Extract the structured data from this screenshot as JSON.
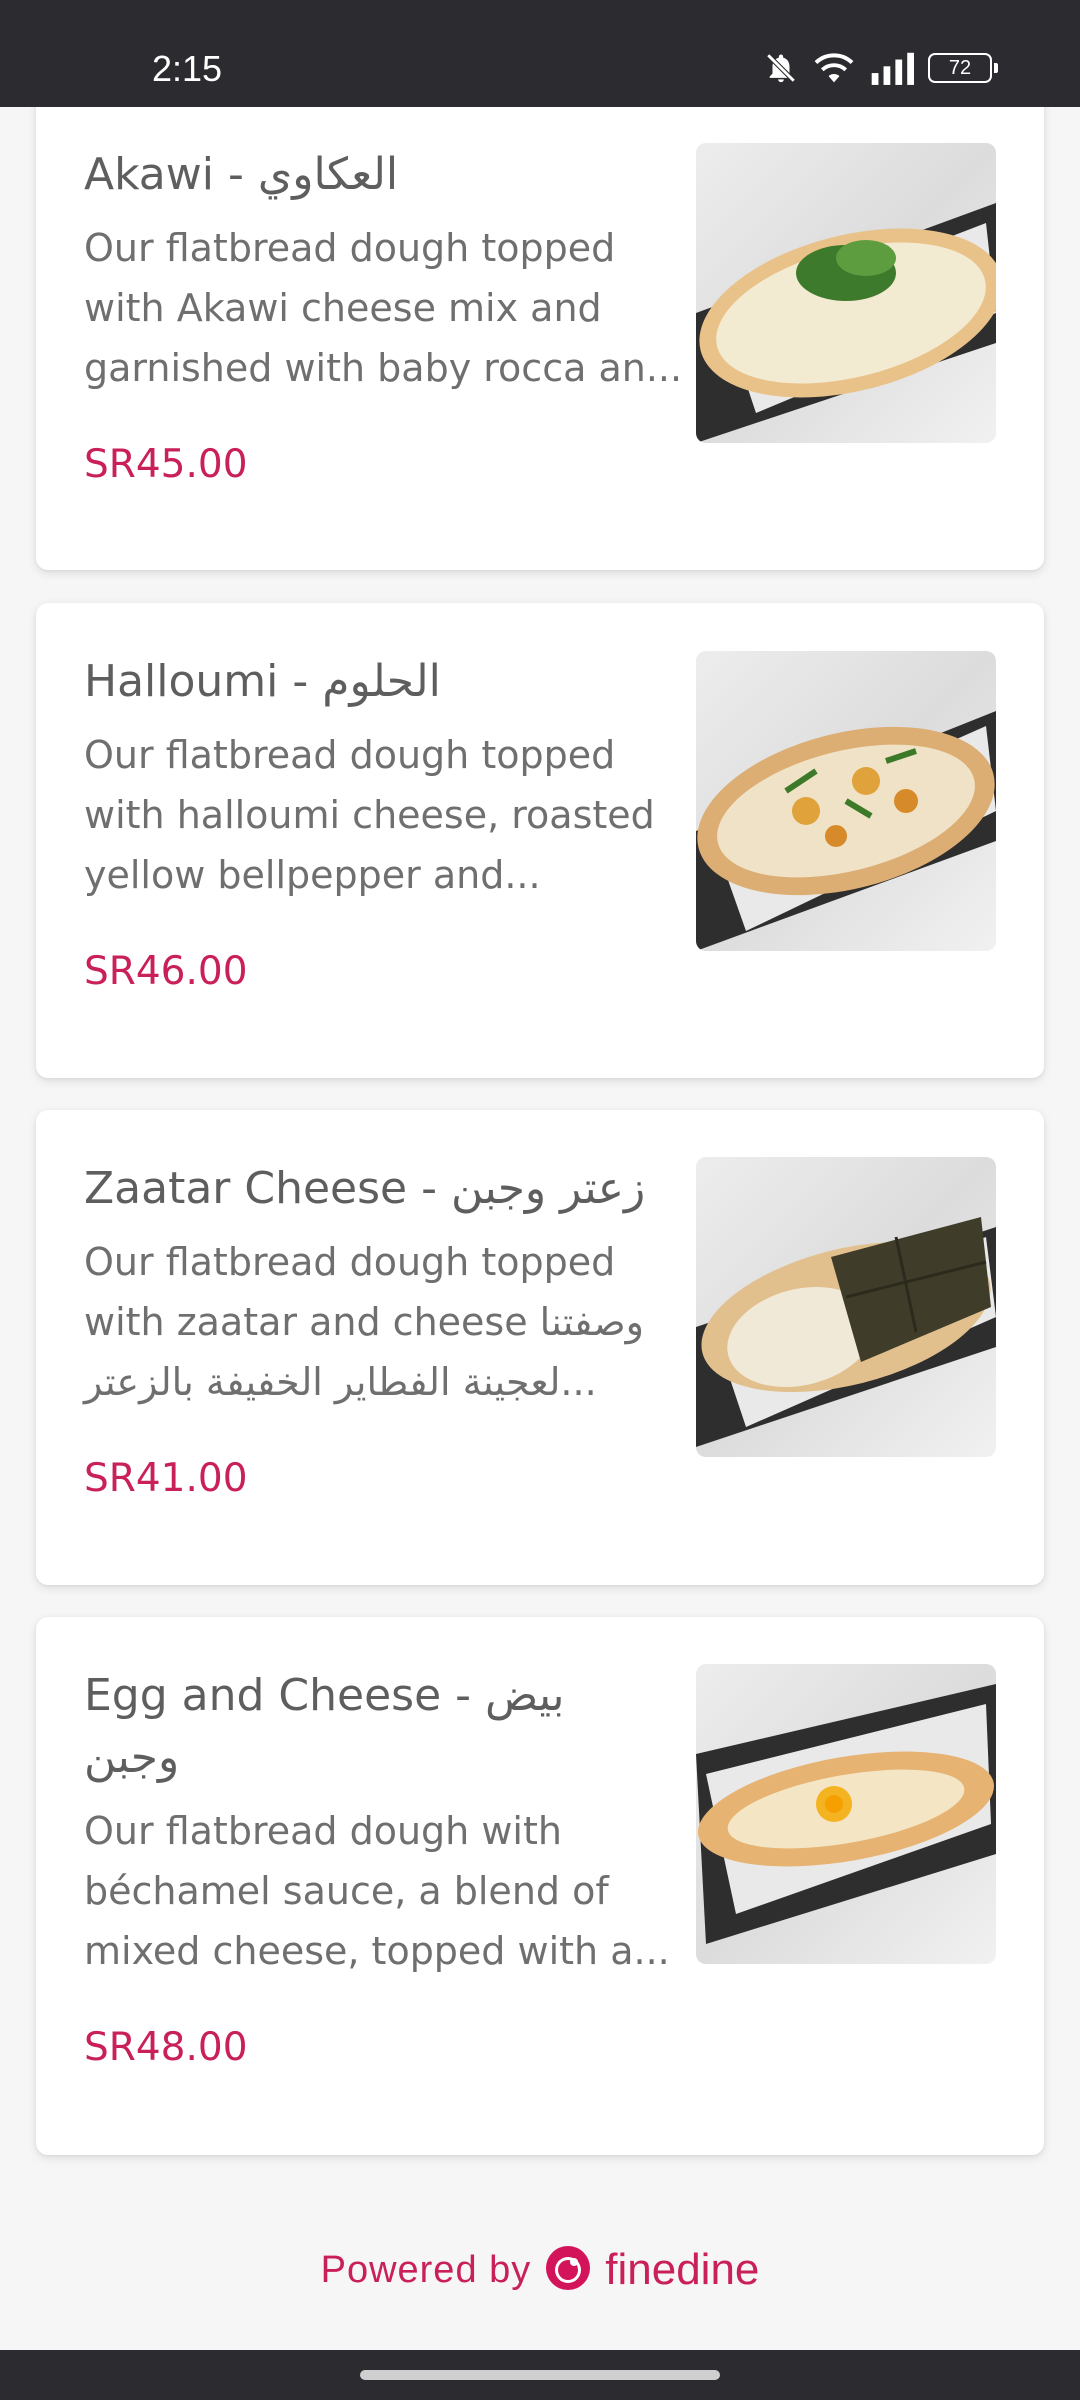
{
  "status": {
    "time": "2:15",
    "battery": "72",
    "icons": [
      "bell-muted-icon",
      "wifi-icon",
      "signal-icon",
      "battery-icon"
    ]
  },
  "items": [
    {
      "title": "Akawi - العكاوي",
      "description_lines": [
        "Our flatbread dough topped",
        "with Akawi cheese mix and",
        "garnished with baby rocca an..."
      ],
      "price": "SR45.00"
    },
    {
      "title": "Halloumi - الحلوم",
      "description_lines": [
        "Our flatbread dough topped",
        "with halloumi cheese, roasted",
        "yellow bellpepper and..."
      ],
      "price": "SR46.00"
    },
    {
      "title": "Zaatar Cheese - زعتر وجبن",
      "description_lines": [
        "Our flatbread dough topped",
        "with zaatar and cheese وصفتنا",
        "لعجينة الفطاير الخفيفة بالزعتر..."
      ],
      "price": "SR41.00"
    },
    {
      "title_lines": [
        "Egg and Cheese - بيض",
        "وجبن"
      ],
      "description_lines": [
        "Our flatbread dough with",
        "béchamel sauce, a blend of",
        "mixed cheese, topped with a..."
      ],
      "price": "SR48.00"
    }
  ],
  "footer": {
    "powered_by": "Powered by",
    "brand": "finedine"
  },
  "colors": {
    "accent": "#c9205a",
    "status_bar": "#2c2c30",
    "title_text": "#5e5e5e",
    "body_text": "#6f6f6f"
  }
}
